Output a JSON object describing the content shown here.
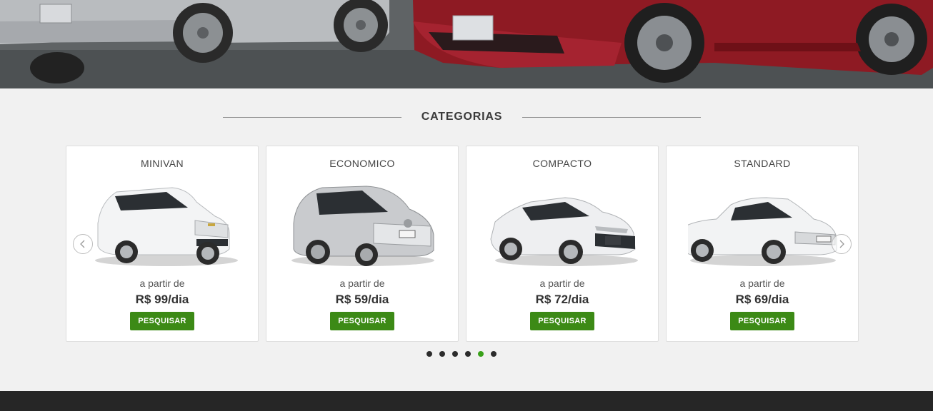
{
  "hero": {
    "alt": "banner-cars"
  },
  "section": {
    "title": "CATEGORIAS"
  },
  "cards": [
    {
      "name": "MINIVAN",
      "from": "a partir de",
      "price": "R$ 99/dia",
      "button": "PESQUISAR"
    },
    {
      "name": "ECONOMICO",
      "from": "a partir de",
      "price": "R$ 59/dia",
      "button": "PESQUISAR"
    },
    {
      "name": "COMPACTO",
      "from": "a partir de",
      "price": "R$ 72/dia",
      "button": "PESQUISAR"
    },
    {
      "name": "STANDARD",
      "from": "a partir de",
      "price": "R$ 69/dia",
      "button": "PESQUISAR"
    }
  ],
  "carousel": {
    "prev_icon": "chevron-left-icon",
    "next_icon": "chevron-right-icon",
    "dots_total": 6,
    "active_dot": 5
  },
  "colors": {
    "accent": "#3c8a16",
    "active_dot": "#3aa11a",
    "footer": "#262626",
    "background": "#f1f1f1"
  }
}
